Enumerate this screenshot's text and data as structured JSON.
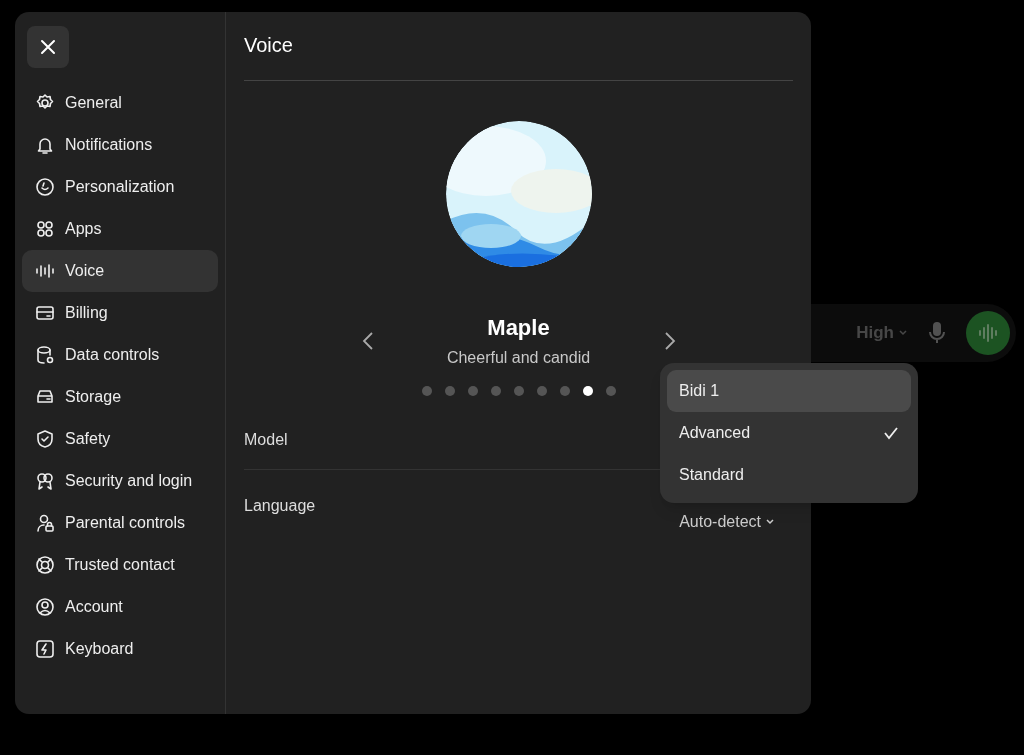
{
  "sidebar": {
    "items": [
      {
        "label": "General",
        "selected": false
      },
      {
        "label": "Notifications",
        "selected": false
      },
      {
        "label": "Personalization",
        "selected": false
      },
      {
        "label": "Apps",
        "selected": false
      },
      {
        "label": "Voice",
        "selected": true
      },
      {
        "label": "Billing",
        "selected": false
      },
      {
        "label": "Data controls",
        "selected": false
      },
      {
        "label": "Storage",
        "selected": false
      },
      {
        "label": "Safety",
        "selected": false
      },
      {
        "label": "Security and login",
        "selected": false
      },
      {
        "label": "Parental controls",
        "selected": false
      },
      {
        "label": "Trusted contact",
        "selected": false
      },
      {
        "label": "Account",
        "selected": false
      },
      {
        "label": "Keyboard",
        "selected": false
      }
    ]
  },
  "header": {
    "title": "Voice"
  },
  "voice": {
    "name": "Maple",
    "description": "Cheerful and candid",
    "dots": [
      {
        "selected": false
      },
      {
        "selected": false
      },
      {
        "selected": false
      },
      {
        "selected": false
      },
      {
        "selected": false
      },
      {
        "selected": false
      },
      {
        "selected": false
      },
      {
        "selected": true
      },
      {
        "selected": false
      }
    ]
  },
  "settings": [
    {
      "label": "Model"
    },
    {
      "label": "Language",
      "value": "Auto-detect"
    }
  ],
  "model_menu": {
    "options": [
      {
        "label": "Bidi 1",
        "highlighted": true,
        "checked": false
      },
      {
        "label": "Advanced",
        "highlighted": false,
        "checked": true
      },
      {
        "label": "Standard",
        "highlighted": false,
        "checked": false
      }
    ]
  },
  "background_bar": {
    "quality": "High"
  }
}
